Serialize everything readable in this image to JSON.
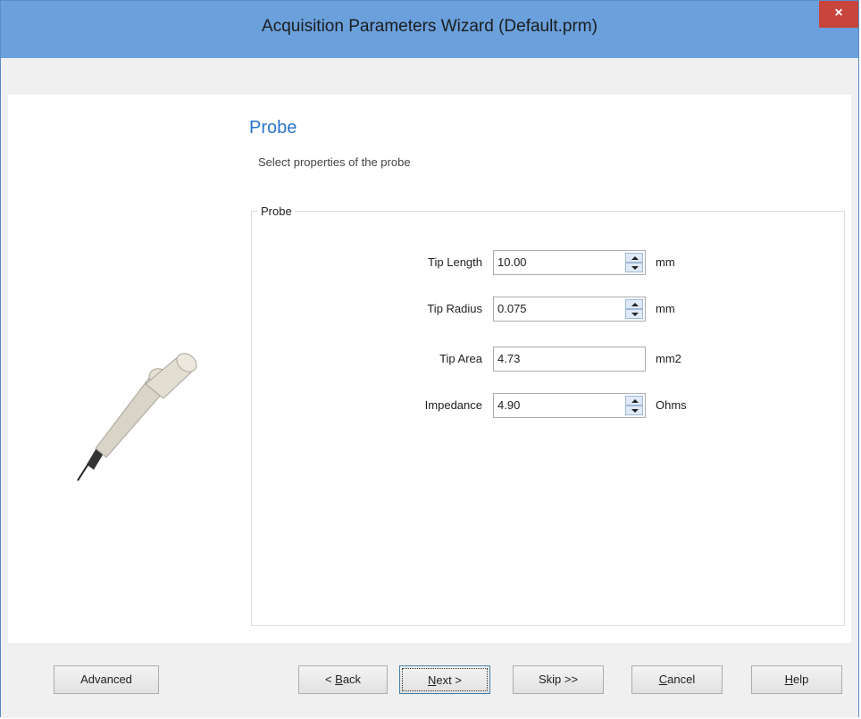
{
  "window": {
    "title": "Acquisition Parameters Wizard (Default.prm)",
    "close_label": "×"
  },
  "page": {
    "heading": "Probe",
    "subheading": "Select properties of the probe"
  },
  "group": {
    "legend": "Probe",
    "fields": [
      {
        "label": "Tip Length",
        "value": "10.00",
        "unit": "mm",
        "spinner": true
      },
      {
        "label": "Tip Radius",
        "value": "0.075",
        "unit": "mm",
        "spinner": true
      },
      {
        "label": "Tip Area",
        "value": "4.73",
        "unit": "mm2",
        "spinner": false
      },
      {
        "label": "Impedance",
        "value": "4.90",
        "unit": "Ohms",
        "spinner": true
      }
    ]
  },
  "buttons": {
    "advanced": "Advanced",
    "back_pre": "< ",
    "back_key": "B",
    "back_post": "ack",
    "next_key": "N",
    "next_post": "ext >",
    "skip": "Skip >>",
    "cancel_key": "C",
    "cancel_post": "ancel",
    "help_key": "H",
    "help_post": "elp"
  },
  "colors": {
    "titlebar": "#6aa0dc",
    "heading": "#2a74cc",
    "close": "#c7453c"
  }
}
